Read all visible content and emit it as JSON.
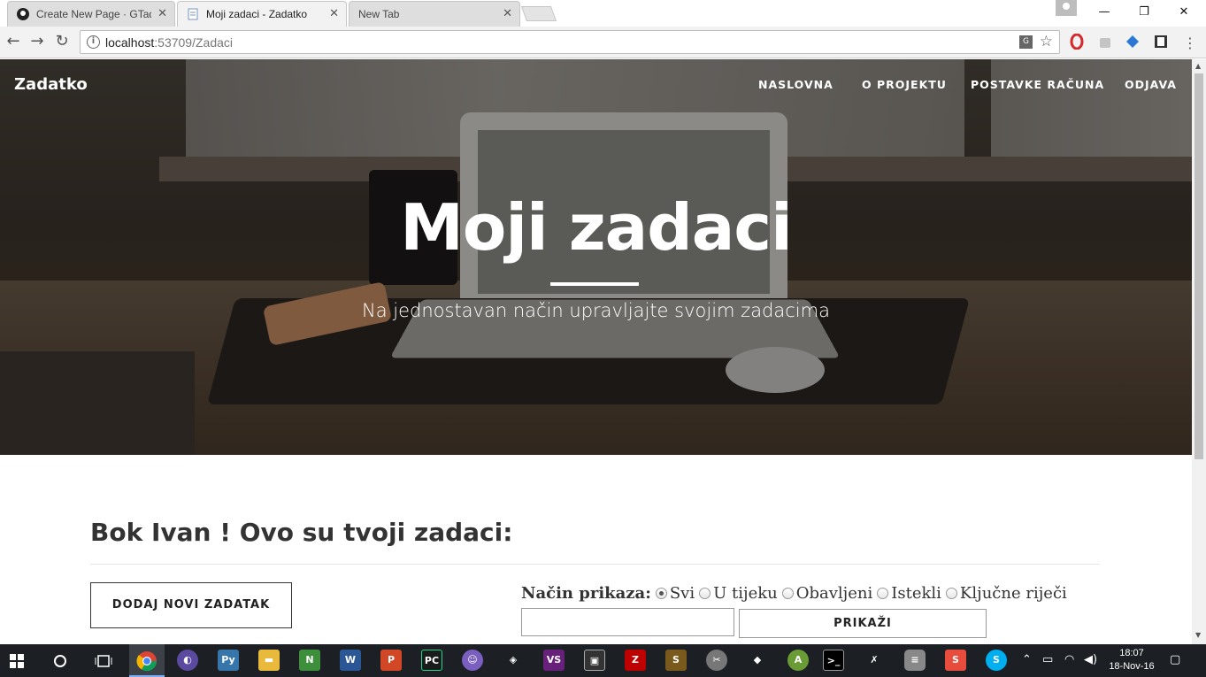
{
  "browser": {
    "tabs": [
      {
        "title": "Create New Page · GTade",
        "active": false
      },
      {
        "title": "Moji zadaci - Zadatko",
        "active": true
      },
      {
        "title": "New Tab",
        "active": false
      }
    ],
    "url_host": "localhost",
    "url_rest": ":53709/Zadaci"
  },
  "site": {
    "brand": "Zadatko",
    "nav": [
      "NASLOVNA",
      "O PROJEKTU",
      "POSTAVKE RAČUNA",
      "ODJAVA"
    ]
  },
  "hero": {
    "title": "Moji zadaci",
    "subtitle": "Na jednostavan način upravljajte svojim zadacima"
  },
  "content": {
    "greeting": "Bok Ivan ! Ovo su tvoji zadaci:",
    "add_button": "DODAJ NOVI ZADATAK",
    "filter_label": "Način prikaza:",
    "filter_options": [
      {
        "label": "Svi",
        "checked": true
      },
      {
        "label": "U tijeku",
        "checked": false
      },
      {
        "label": "Obavljeni",
        "checked": false
      },
      {
        "label": "Istekli",
        "checked": false
      },
      {
        "label": "Ključne riječi",
        "checked": false
      }
    ],
    "keyword_value": "",
    "show_button": "PRIKAŽI"
  },
  "taskbar": {
    "time": "18:07",
    "date": "18-Nov-16"
  }
}
